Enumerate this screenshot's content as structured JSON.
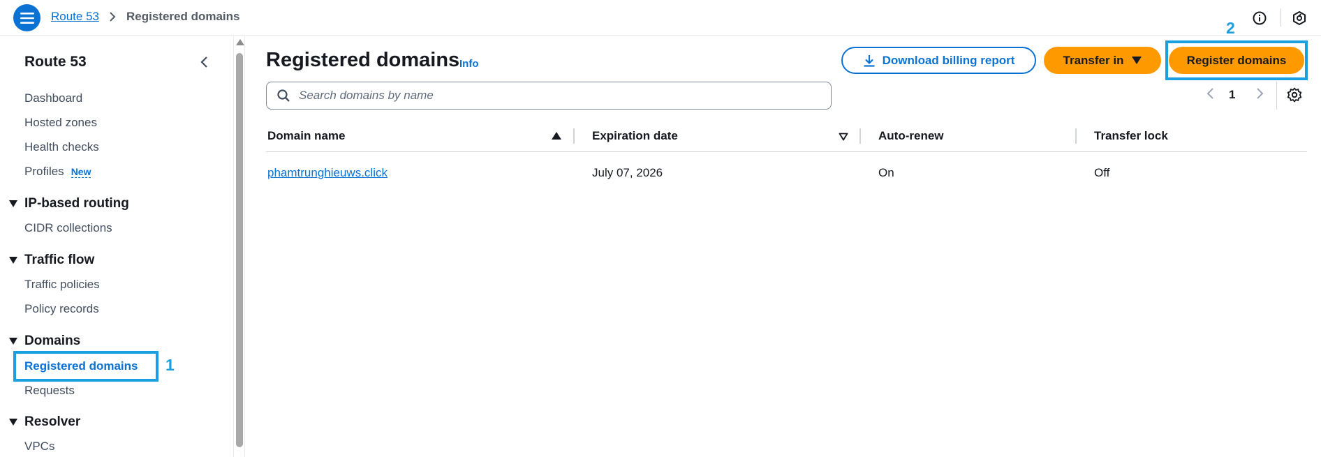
{
  "breadcrumb": {
    "root": "Route 53",
    "current": "Registered domains"
  },
  "icons": {
    "menu": "hamburger-menu-icon",
    "info": "info-circle-icon",
    "settings": "unified-settings-icon",
    "close_nav": "chevron-left-icon",
    "download": "download-icon",
    "search": "search-icon",
    "gear": "gear-icon"
  },
  "sidebar": {
    "title": "Route 53",
    "items": [
      {
        "label": "Dashboard"
      },
      {
        "label": "Hosted zones"
      },
      {
        "label": "Health checks"
      },
      {
        "label": "Profiles",
        "badge": "New"
      }
    ],
    "sections": [
      {
        "title": "IP-based routing",
        "items": [
          {
            "label": "CIDR collections"
          }
        ]
      },
      {
        "title": "Traffic flow",
        "items": [
          {
            "label": "Traffic policies"
          },
          {
            "label": "Policy records"
          }
        ]
      },
      {
        "title": "Domains",
        "items": [
          {
            "label": "Registered domains",
            "active": true
          },
          {
            "label": "Requests"
          }
        ]
      },
      {
        "title": "Resolver",
        "items": [
          {
            "label": "VPCs"
          }
        ]
      }
    ]
  },
  "annotations": {
    "first": "1",
    "second": "2"
  },
  "main": {
    "title": "Registered domains",
    "info": "Info",
    "buttons": {
      "download": "Download billing report",
      "transfer": "Transfer in",
      "register": "Register domains"
    },
    "search": {
      "placeholder": "Search domains by name"
    },
    "pagination": {
      "page": "1"
    }
  },
  "table": {
    "columns": [
      "Domain name",
      "Expiration date",
      "Auto-renew",
      "Transfer lock"
    ],
    "rows": [
      {
        "domain": "phamtrunghieuws.click",
        "expiration": "July 07, 2026",
        "auto_renew": "On",
        "transfer_lock": "Off"
      }
    ]
  },
  "colors": {
    "accent": "#0972d3",
    "primary_button": "#ff9900",
    "annotation": "#1a9fe0"
  }
}
